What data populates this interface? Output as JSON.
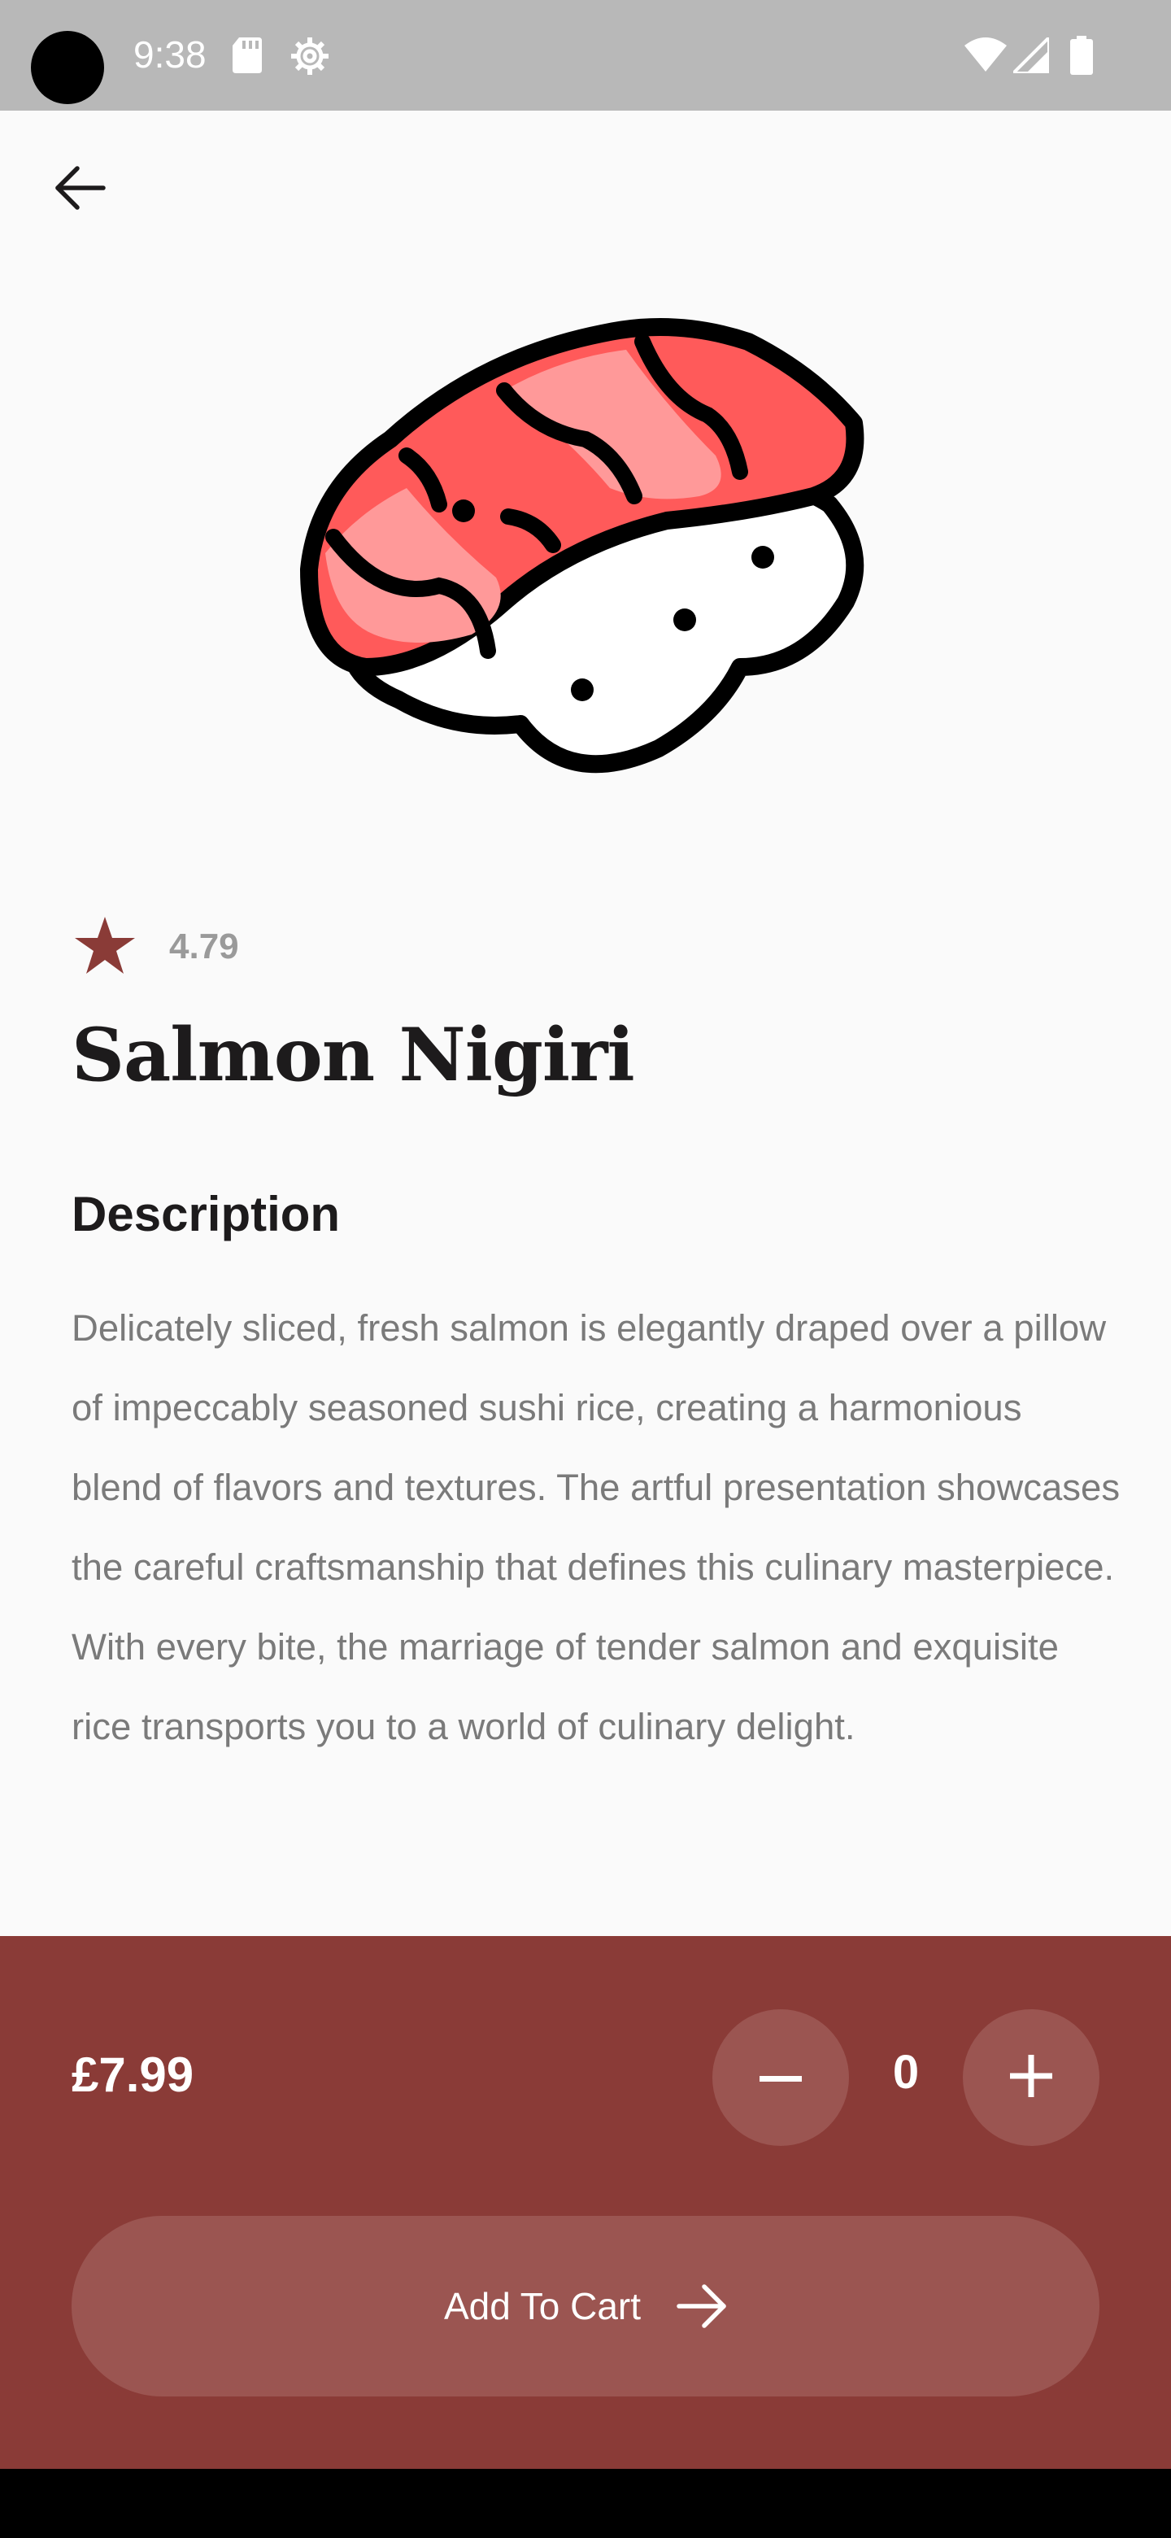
{
  "status_bar": {
    "time": "9:38",
    "icons": [
      "sd-card-icon",
      "settings-icon",
      "wifi-icon",
      "signal-icon",
      "battery-icon"
    ]
  },
  "nav": {
    "back_icon": "arrow-left-icon"
  },
  "product": {
    "image_icon": "salmon-nigiri-icon",
    "rating": "4.79",
    "rating_icon": "star-icon",
    "title": "Salmon Nigiri",
    "description_heading": "Description",
    "description": "Delicately sliced, fresh salmon is elegantly draped over a pillow of impeccably seasoned sushi rice, creating a harmonious blend of flavors and textures. The artful presentation showcases the careful craftsmanship that defines this culinary masterpiece. With every bite, the marriage of tender salmon and exquisite rice transports you to a world of culinary delight."
  },
  "cart_panel": {
    "price": "£7.99",
    "quantity": "0",
    "minus_icon": "minus-icon",
    "plus_icon": "plus-icon",
    "add_to_cart_label": "Add To Cart",
    "add_to_cart_icon": "arrow-right-icon"
  },
  "colors": {
    "accent": "#8a3b37",
    "accent_light": "#9b5551",
    "star": "#8a3b37",
    "salmon_dark": "#ff5a5a",
    "salmon_light": "#ff9999"
  }
}
